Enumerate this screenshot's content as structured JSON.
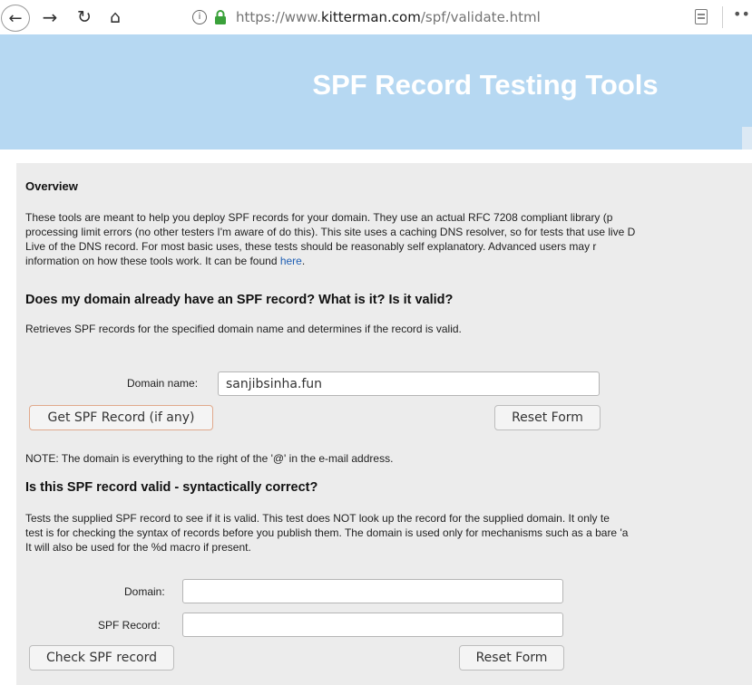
{
  "browser": {
    "url_prefix": "https://www.",
    "url_domain": "kitterman.com",
    "url_path": "/spf/validate.html",
    "info_glyph": "i",
    "more_glyph": "•••"
  },
  "banner": {
    "title": "SPF Record Testing Tools"
  },
  "overview": {
    "heading": "Overview",
    "lines": [
      "These tools are meant to help you deploy SPF records for your domain. They use an actual RFC 7208 compliant library (p",
      "processing limit errors (no other testers I'm aware of do this). This site uses a caching DNS resolver, so for tests that use live D",
      "Live of the DNS record. For most basic uses, these tests should be reasonably self explanatory. Advanced users may r",
      "information on how these tools work. It can be found "
    ],
    "link_text": "here",
    "link_suffix": "."
  },
  "lookup": {
    "heading": "Does my domain already have an SPF record? What is it? Is it valid?",
    "description": "Retrieves SPF records for the specified domain name and determines if the record is valid.",
    "domain_label": "Domain name:",
    "domain_value": "sanjibsinha.fun",
    "get_button": "Get SPF Record (if any)",
    "reset_button": "Reset Form",
    "note": "NOTE: The domain is everything to the right of the '@' in the e-mail address."
  },
  "validate": {
    "heading": "Is this SPF record valid - syntactically correct?",
    "lines": [
      "Tests the supplied SPF record to see if it is valid. This test does NOT look up the record for the supplied domain. It only te",
      "test is for checking the syntax of records before you publish them. The domain is used only for mechanisms such as a bare 'a",
      "It will also be used for the %d macro if present."
    ],
    "domain_label": "Domain:",
    "domain_value": "",
    "record_label": "SPF Record:",
    "record_value": "",
    "check_button": "Check SPF record",
    "reset_button": "Reset Form"
  },
  "colors": {
    "banner": "#b6d8f2",
    "content_bg": "#ececec",
    "link": "#1f5fb4",
    "lock": "#3aa13a"
  }
}
